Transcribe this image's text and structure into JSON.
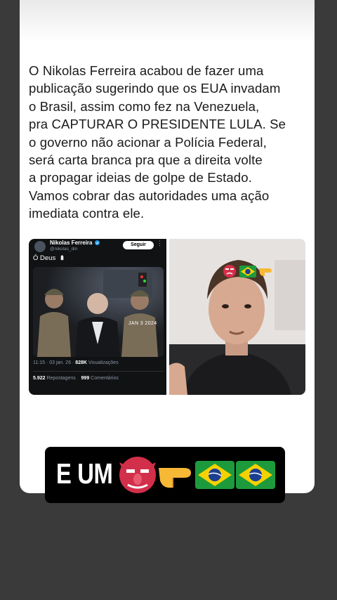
{
  "post": {
    "lines": [
      "O Nikolas Ferreira acabou de fazer uma",
      "publicação sugerindo que os EUA invadam",
      "o Brasil, assim como fez na Venezuela,",
      "pra CAPTURAR O PRESIDENTE LULA. Se",
      "o governo não acionar a Polícia Federal,",
      "será carta branca pra que a direita volte",
      "a propagar ideias de golpe de Estado.",
      "Vamos cobrar  das autoridades uma ação",
      "imediata contra ele."
    ]
  },
  "tweet": {
    "author_name": "Nikolas Ferreira",
    "author_handle": "@nikolas_dm",
    "follow_label": "Seguir",
    "text": "Ó Deus",
    "photo_date": "JAN  3 2024",
    "time": "11:15 · 03 jan. 26 ·",
    "views_count": "828K",
    "views_label": "Visualizações",
    "reposts_count": "5.922",
    "reposts_label": "Repostagens",
    "comments_count": "999",
    "comments_label": "Comentários"
  },
  "caption": {
    "text": "E UM"
  },
  "icons": [
    "verified-badge-icon",
    "more-options-icon",
    "goblin-emoji",
    "pointing-right-emoji",
    "brazil-flag-emoji",
    "hand-emoji"
  ],
  "colors": {
    "background": "#3a3a3a",
    "card": "#ffffff",
    "caption_bar": "#000000",
    "tweet_bg": "#101214",
    "verified_blue": "#1d9bf0"
  }
}
